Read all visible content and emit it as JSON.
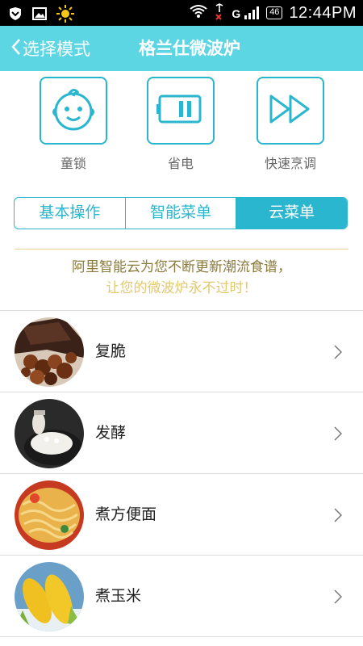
{
  "status_bar": {
    "signal_text": "G",
    "battery": "46",
    "time": "12:44PM"
  },
  "header": {
    "back_label": "选择模式",
    "title": "格兰仕微波炉"
  },
  "features": [
    {
      "label": "童锁",
      "icon": "baby-face-icon"
    },
    {
      "label": "省电",
      "icon": "battery-icon"
    },
    {
      "label": "快速烹调",
      "icon": "fast-forward-icon"
    }
  ],
  "tabs": [
    {
      "label": "基本操作",
      "active": false
    },
    {
      "label": "智能菜单",
      "active": false
    },
    {
      "label": "云菜单",
      "active": true
    }
  ],
  "promo": {
    "line1": "阿里智能云为您不断更新潮流食谱，",
    "line2": "让您的微波炉永不过时！"
  },
  "recipes": [
    {
      "name": "复脆",
      "image": "caramel-popcorn-chocolate-photo"
    },
    {
      "name": "发酵",
      "image": "rice-dish-photo"
    },
    {
      "name": "煮方便面",
      "image": "instant-noodles-photo"
    },
    {
      "name": "煮玉米",
      "image": "corn-photo"
    }
  ],
  "colors": {
    "accent": "#2bb6cf",
    "header_bg": "#5dd6e4",
    "promo_dark": "#8a7a3c",
    "promo_light": "#e2c86f"
  }
}
